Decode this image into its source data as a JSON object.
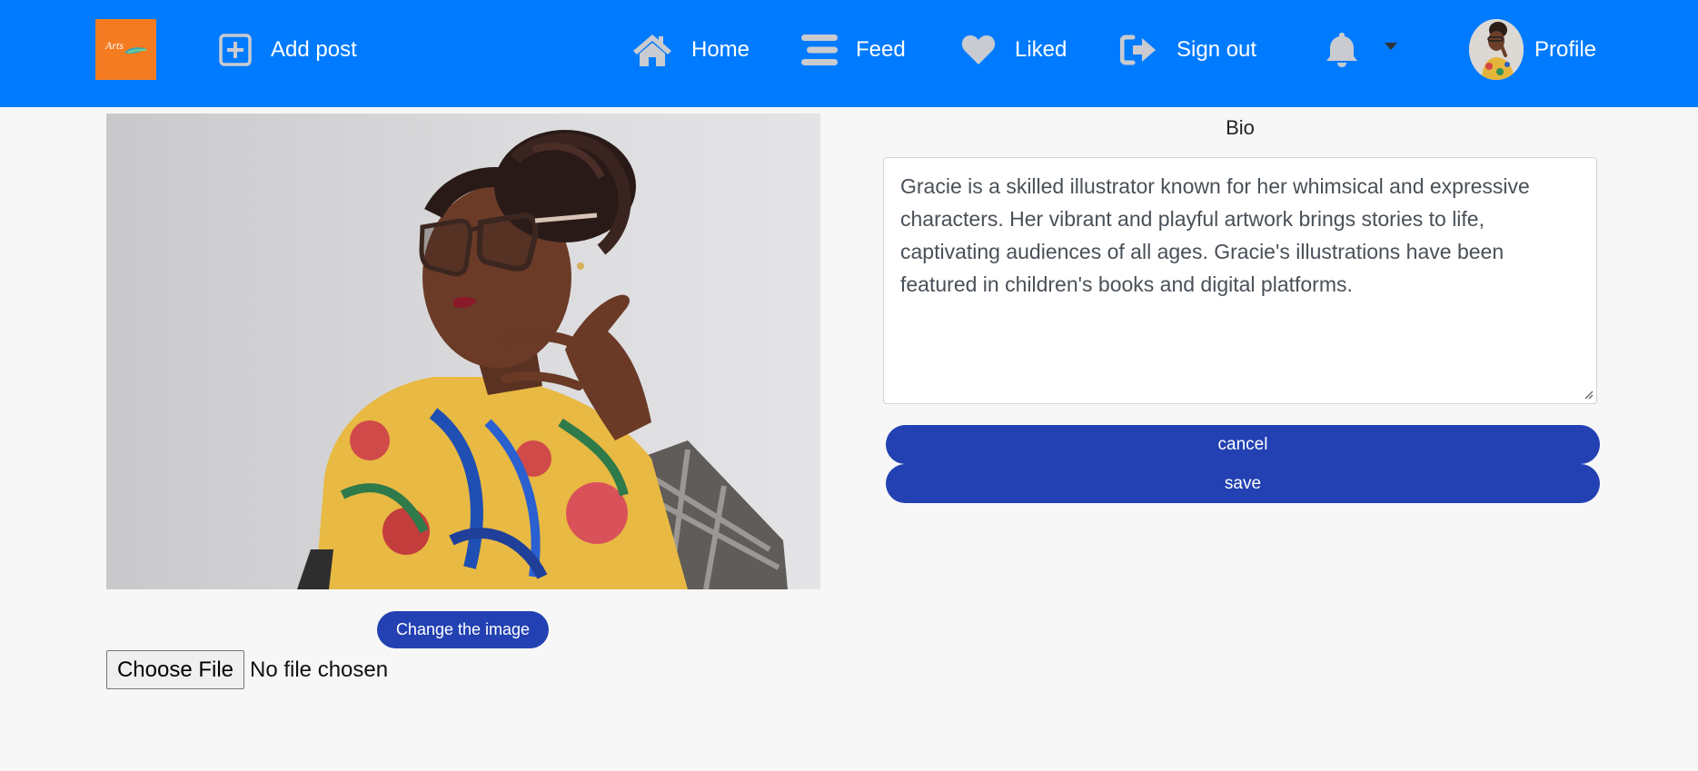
{
  "navbar": {
    "logo_text": "Arts",
    "add_post_label": "Add post",
    "home_label": "Home",
    "feed_label": "Feed",
    "liked_label": "Liked",
    "signout_label": "Sign out",
    "profile_label": "Profile"
  },
  "editor": {
    "change_image_label": "Change the image",
    "choose_file_label": "Choose File",
    "file_status": "No file chosen",
    "bio_label": "Bio",
    "bio_text": "Gracie is a skilled illustrator known for her whimsical and expressive characters. Her vibrant and playful artwork brings stories to life, captivating audiences of all ages. Gracie's illustrations have been featured in children's books and digital platforms.",
    "cancel_label": "cancel",
    "save_label": "save"
  },
  "colors": {
    "navbar": "#007bff",
    "button": "#2341b2",
    "logo": "#f47b20"
  },
  "icons": [
    "plus-square-icon",
    "home-icon",
    "bars-icon",
    "heart-icon",
    "sign-out-icon",
    "bell-icon",
    "caret-down-icon"
  ]
}
